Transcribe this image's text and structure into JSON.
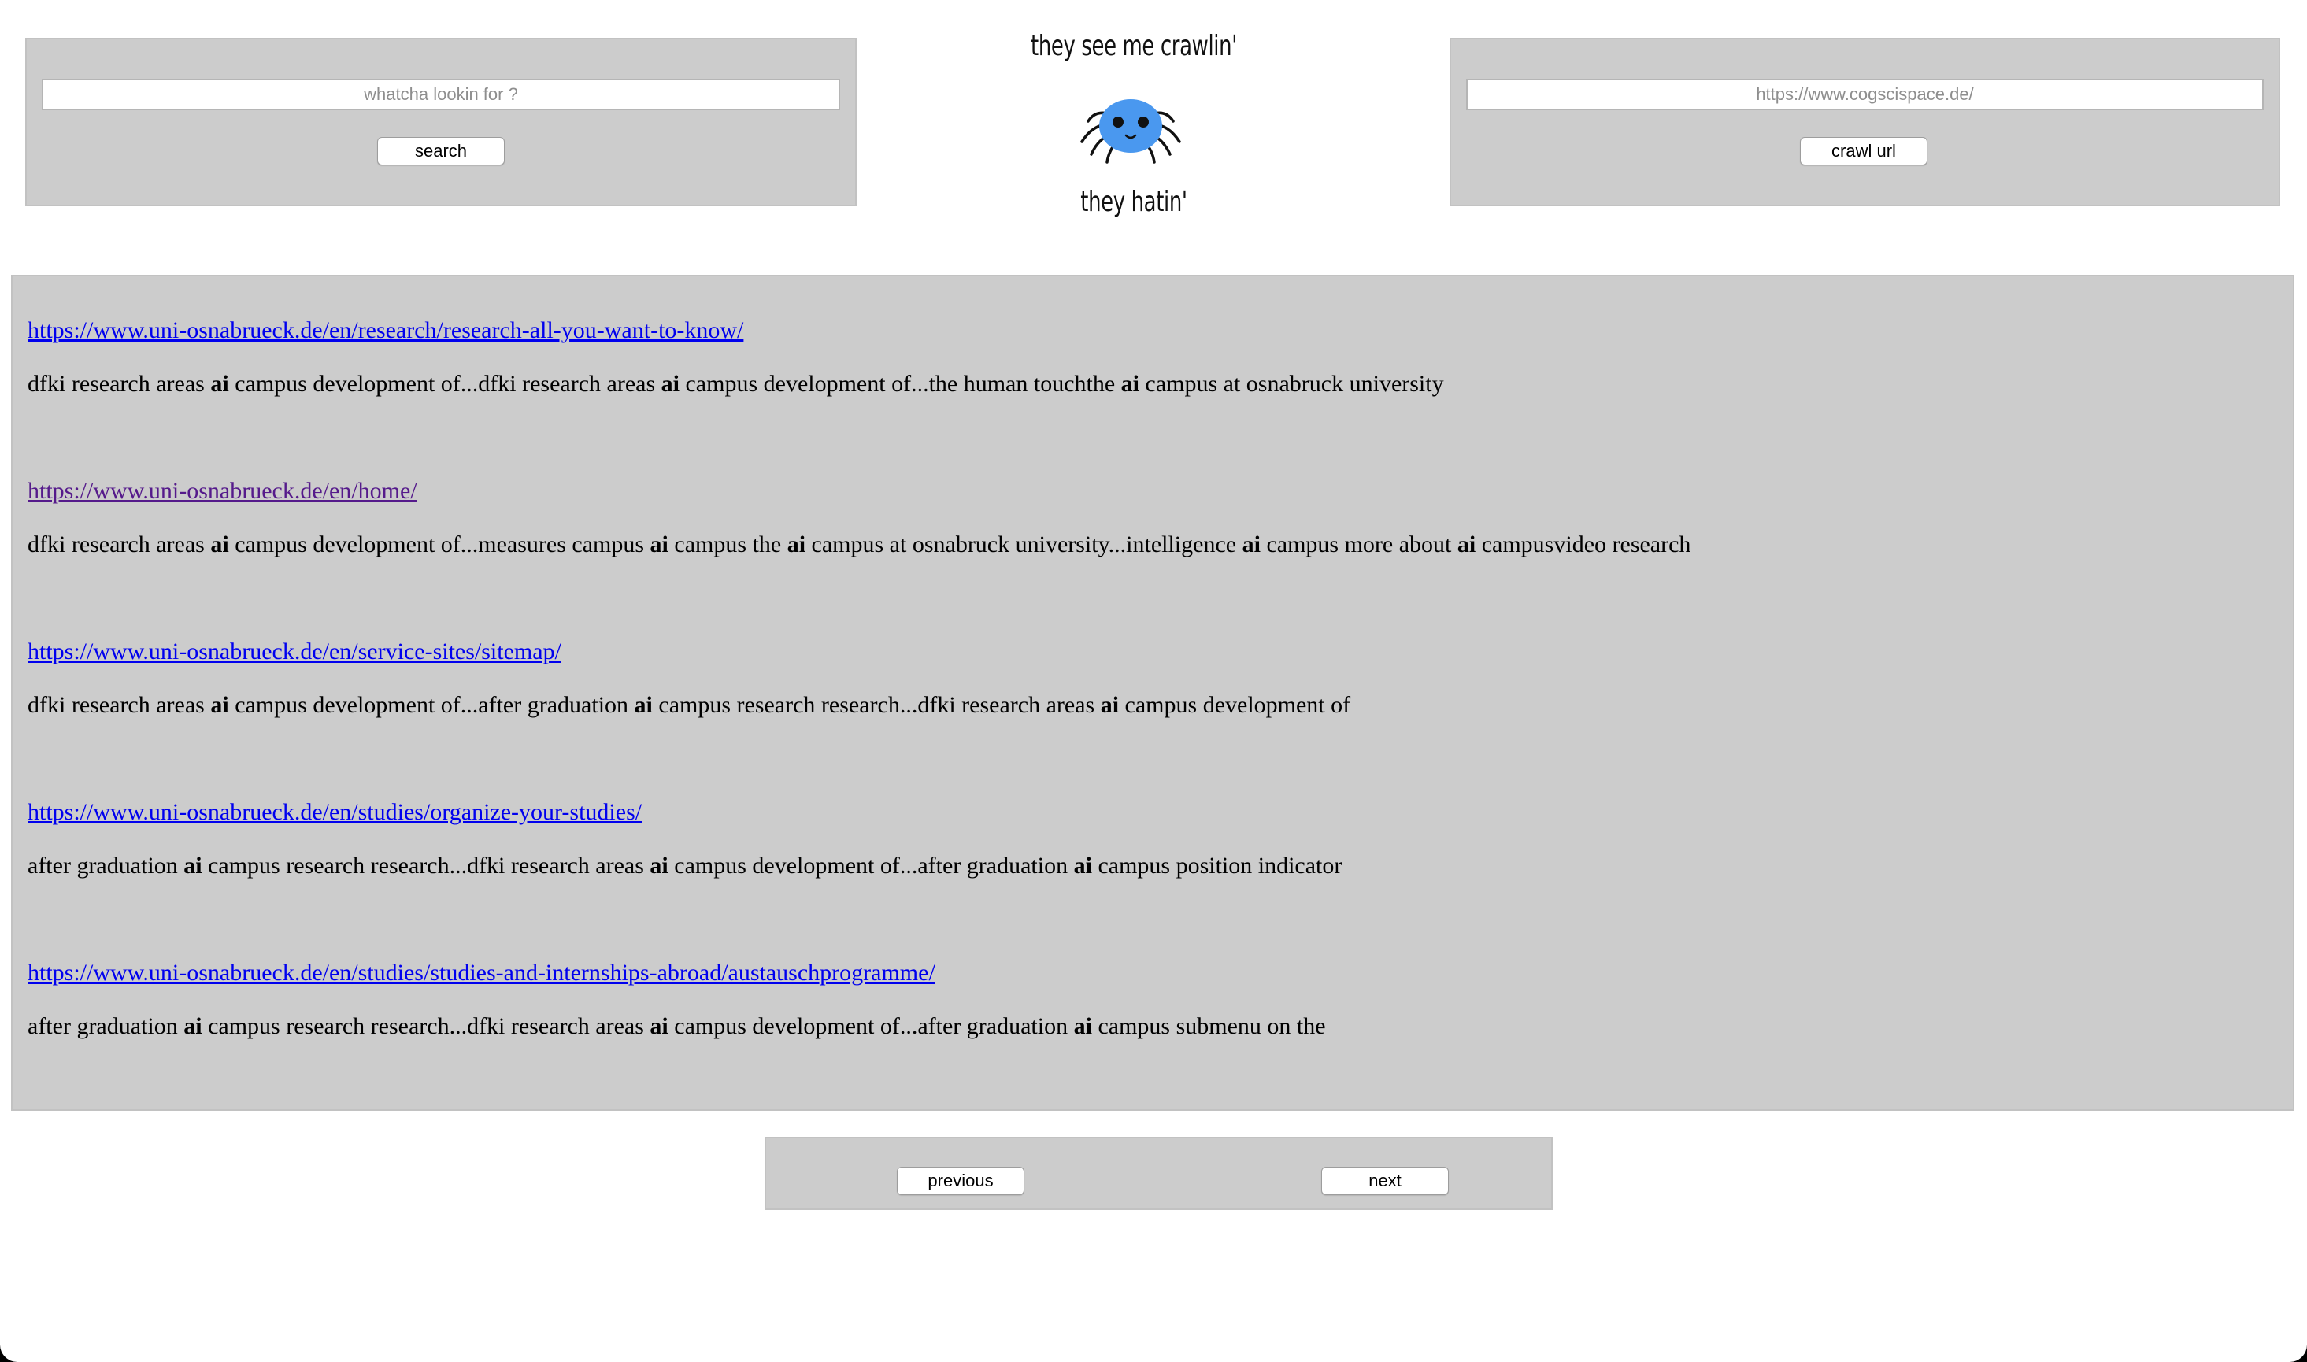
{
  "search": {
    "placeholder": "whatcha lookin for ?",
    "button_label": "search"
  },
  "logo": {
    "line1": "they see me crawlin'",
    "line2": "they hatin'",
    "icon": "spider-icon",
    "spider_color": "#4a98ef"
  },
  "crawl": {
    "placeholder": "https://www.cogscispace.de/",
    "button_label": "crawl url"
  },
  "results": [
    {
      "url": "https://www.uni-osnabrueck.de/en/research/research-all-you-want-to-know/",
      "visited": false,
      "snippet": [
        "dfki research areas ",
        "ai",
        " campus development of...dfki research areas ",
        "ai",
        " campus development of...the human touchthe ",
        "ai",
        " campus at osnabruck university"
      ]
    },
    {
      "url": "https://www.uni-osnabrueck.de/en/home/",
      "visited": true,
      "snippet": [
        "dfki research areas ",
        "ai",
        " campus development of...measures campus ",
        "ai",
        " campus the ",
        "ai",
        " campus at osnabruck university...intelligence ",
        "ai",
        " campus more about ",
        "ai",
        " campusvideo research"
      ]
    },
    {
      "url": "https://www.uni-osnabrueck.de/en/service-sites/sitemap/",
      "visited": false,
      "snippet": [
        "dfki research areas ",
        "ai",
        " campus development of...after graduation ",
        "ai",
        " campus research research...dfki research areas ",
        "ai",
        " campus development of"
      ]
    },
    {
      "url": "https://www.uni-osnabrueck.de/en/studies/organize-your-studies/",
      "visited": false,
      "snippet": [
        "after graduation ",
        "ai",
        " campus research research...dfki research areas ",
        "ai",
        " campus development of...after graduation ",
        "ai",
        " campus position indicator"
      ]
    },
    {
      "url": "https://www.uni-osnabrueck.de/en/studies/studies-and-internships-abroad/austauschprogramme/",
      "visited": false,
      "snippet": [
        "after graduation ",
        "ai",
        " campus research research...dfki research areas ",
        "ai",
        " campus development of...after graduation ",
        "ai",
        " campus submenu on the"
      ]
    }
  ],
  "pager": {
    "previous_label": "previous",
    "next_label": "next"
  },
  "colors": {
    "panel": "#cccccc",
    "link": "#0000ee",
    "visited_link": "#551a8b"
  }
}
